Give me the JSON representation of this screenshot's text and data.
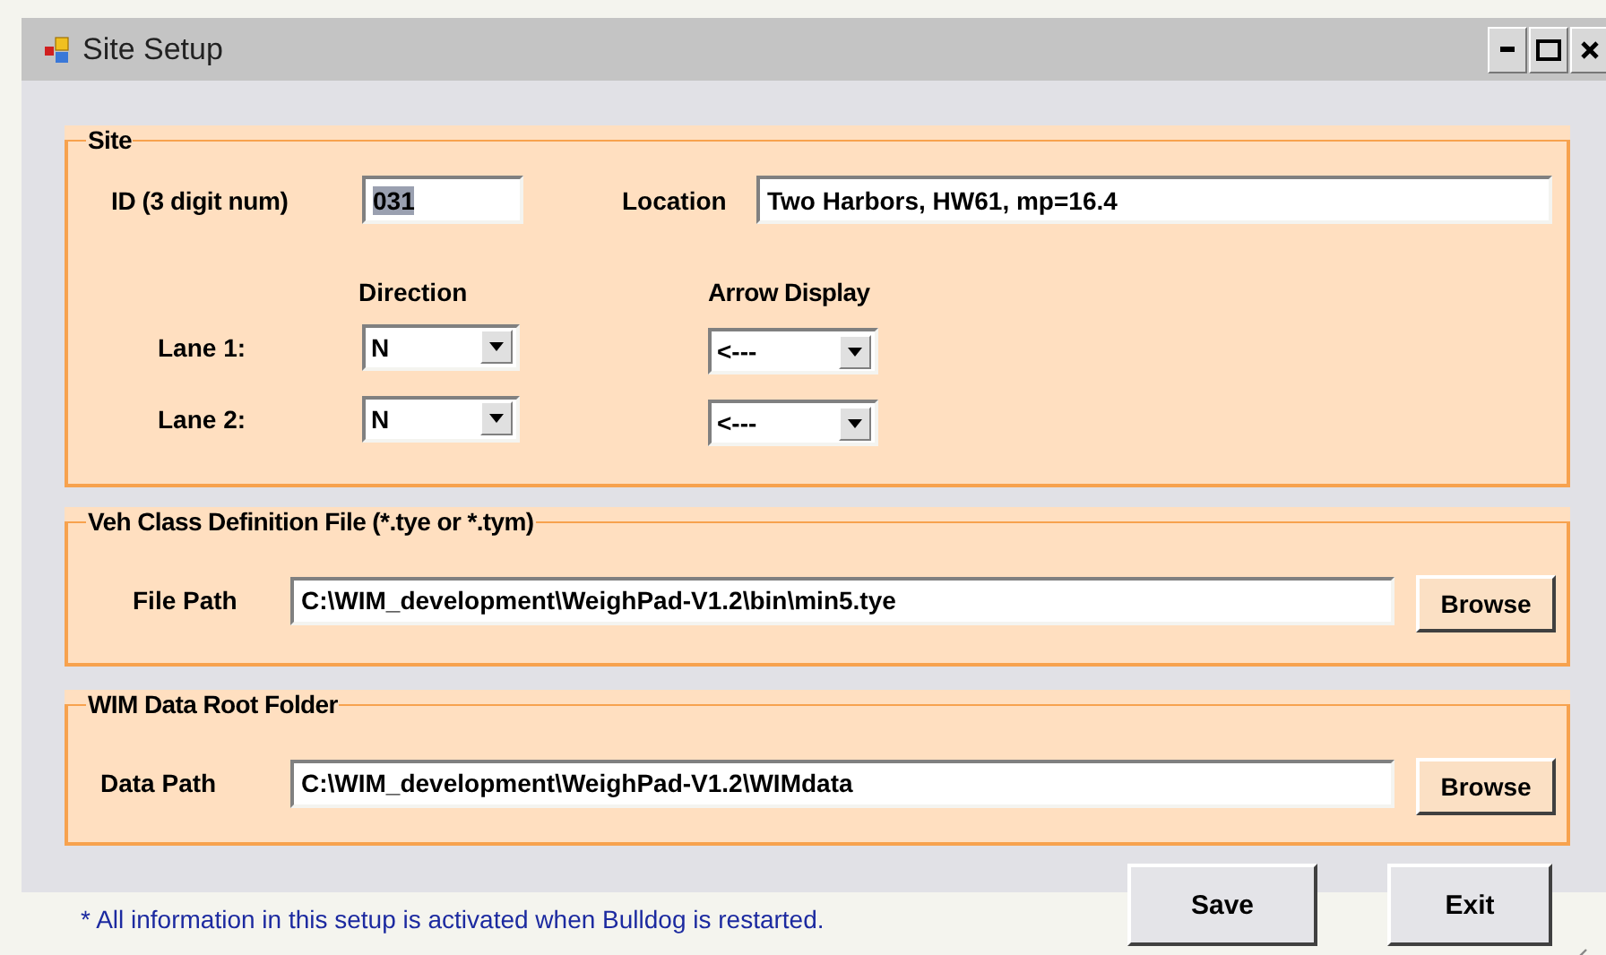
{
  "window": {
    "title": "Site Setup"
  },
  "site": {
    "title": "Site",
    "id_label": "ID (3 digit num)",
    "id_value": "031",
    "id_text_selected": true,
    "location_label": "Location",
    "location_value": "Two Harbors, HW61, mp=16.4",
    "direction_header": "Direction",
    "arrow_header": "Arrow Display",
    "lanes": [
      {
        "label": "Lane 1:",
        "direction": "N",
        "arrow": "<---"
      },
      {
        "label": "Lane 2:",
        "direction": "N",
        "arrow": "<---"
      }
    ]
  },
  "files": [
    {
      "title": "Veh Class Definition File (*.tye or *.tym)",
      "label": "File Path",
      "value": "C:\\WIM_development\\WeighPad-V1.2\\bin\\min5.tye",
      "button": "Browse"
    },
    {
      "title": "WIM Data Root Folder",
      "label": "Data Path",
      "value": "C:\\WIM_development\\WeighPad-V1.2\\WIMdata",
      "button": "Browse"
    }
  ],
  "note": "* All information in this setup is activated when Bulldog is restarted.",
  "buttons": [
    "Save",
    "Exit"
  ]
}
